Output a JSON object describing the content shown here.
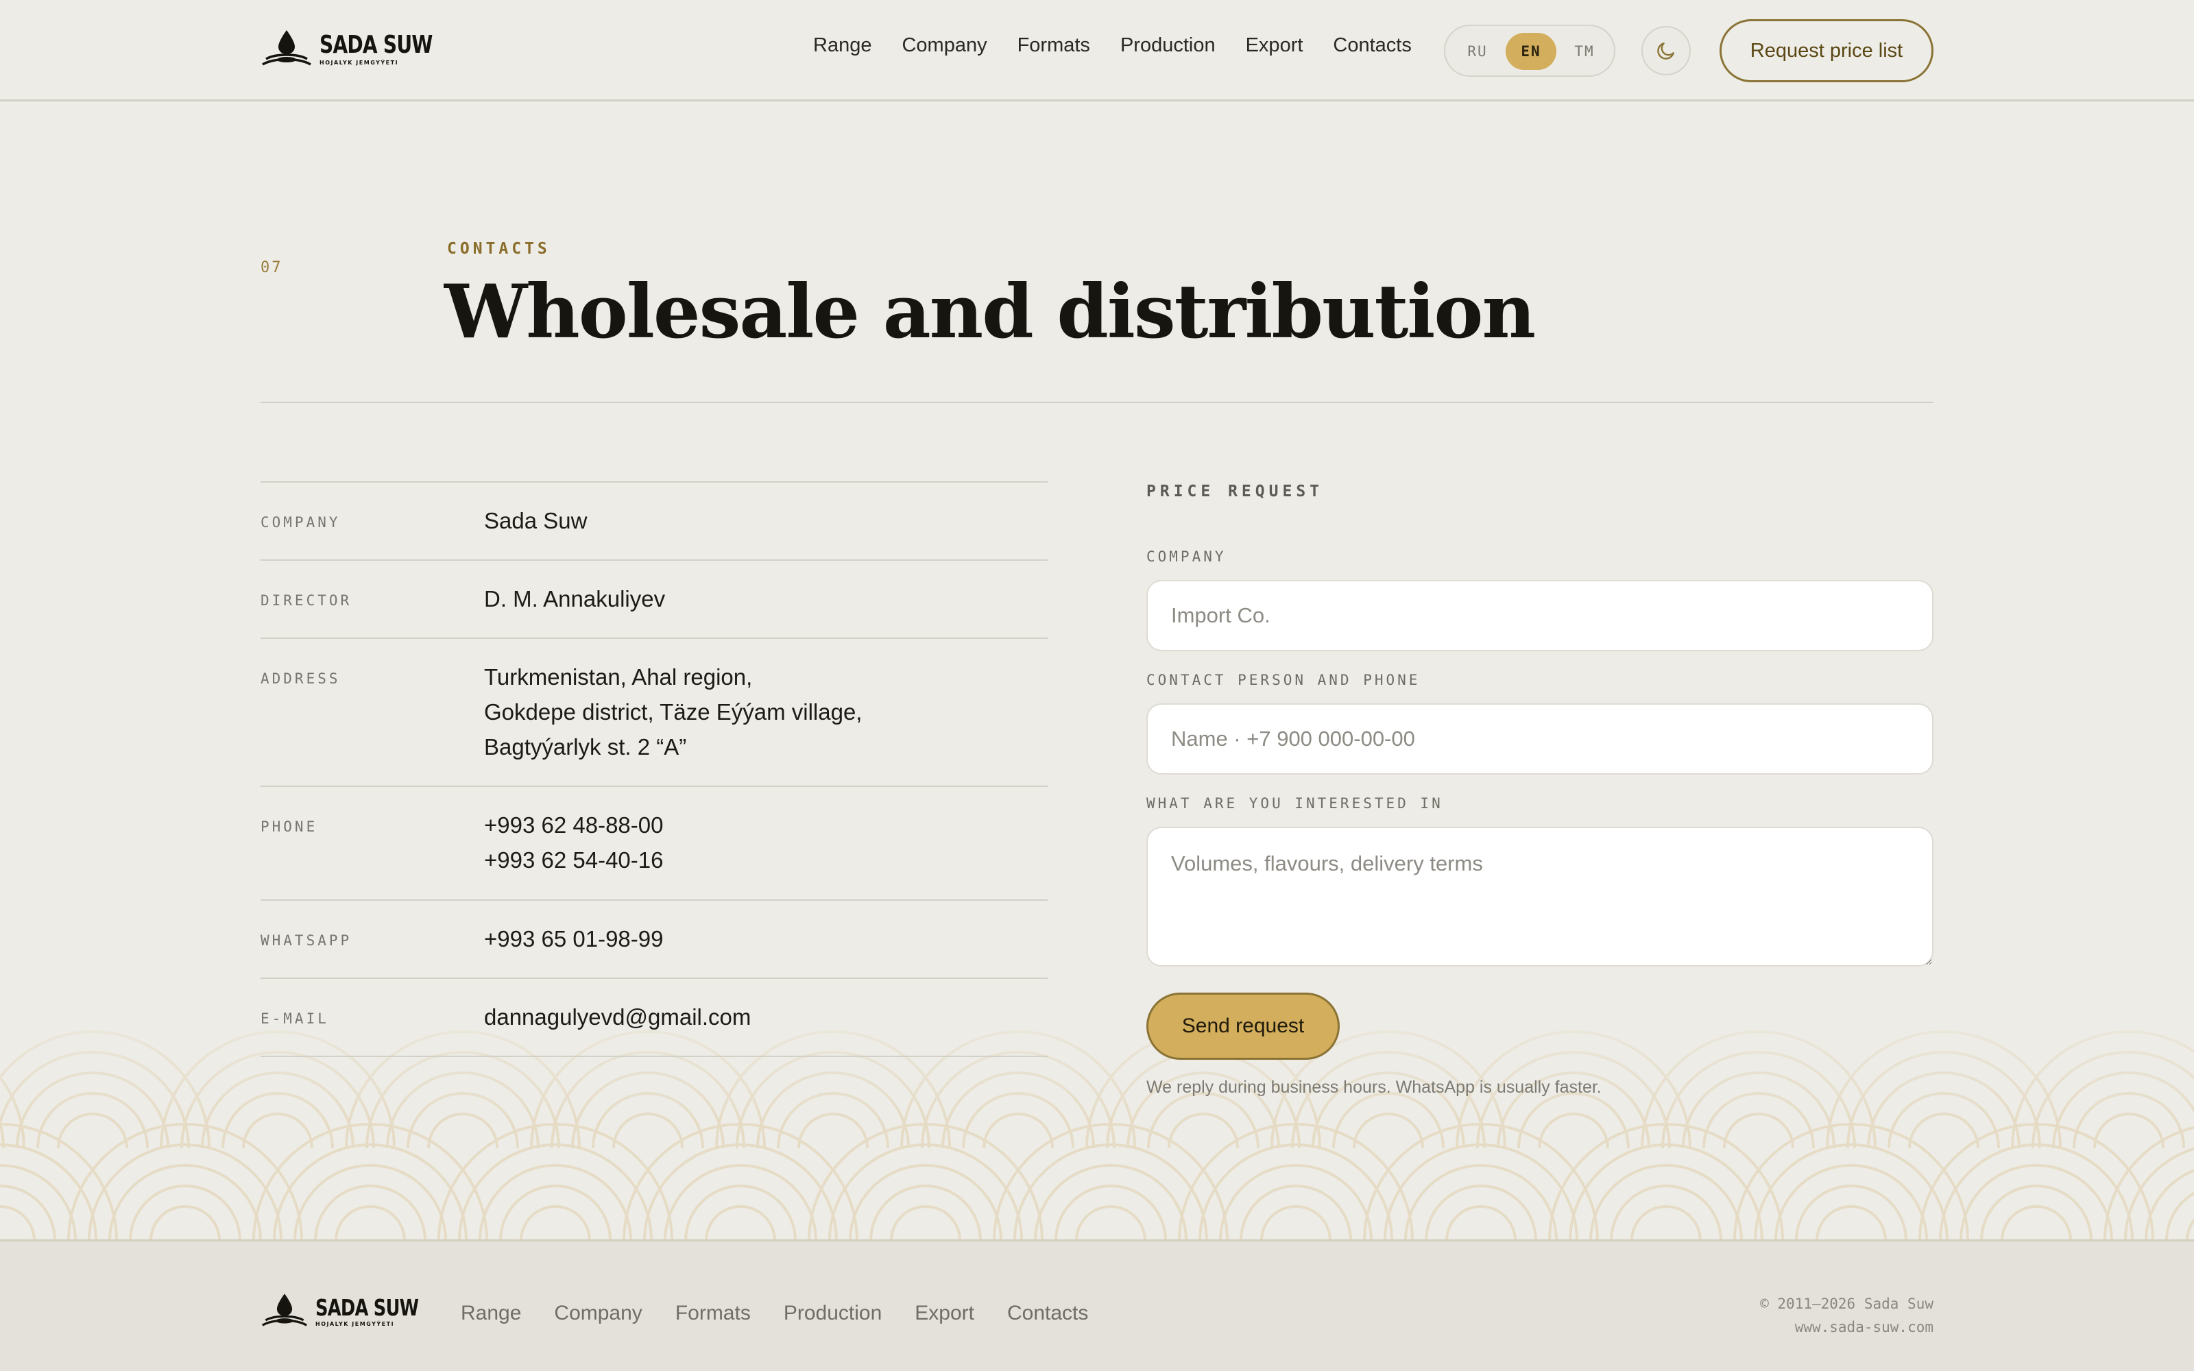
{
  "header": {
    "brand": "SADA SUW",
    "brand_sub": "HOJALYK JEMGYÝETI",
    "nav": [
      "Range",
      "Company",
      "Formats",
      "Production",
      "Export",
      "Contacts"
    ],
    "languages": [
      "RU",
      "EN",
      "TM"
    ],
    "active_language": "EN",
    "theme_icon": "moon-icon",
    "cta_label": "Request price list"
  },
  "section": {
    "number": "07",
    "eyebrow": "CONTACTS",
    "title": "Wholesale and distribution"
  },
  "contacts": [
    {
      "key": "COMPANY",
      "value": "Sada Suw"
    },
    {
      "key": "DIRECTOR",
      "value": "D. M. Annakuliyev"
    },
    {
      "key": "ADDRESS",
      "lines": [
        "Turkmenistan, Ahal region,",
        "Gokdepe district, Täze Eýýam village,",
        "Bagtyýarlyk st. 2 “A”"
      ]
    },
    {
      "key": "PHONE",
      "lines": [
        "+993 62 48-88-00",
        "+993 62 54-40-16"
      ]
    },
    {
      "key": "WHATSAPP",
      "value": "+993 65 01-98-99"
    },
    {
      "key": "E-MAIL",
      "value": "dannagulyevd@gmail.com"
    }
  ],
  "form": {
    "title": "PRICE REQUEST",
    "company_label": "COMPANY",
    "company_placeholder": "Import Co.",
    "contact_label": "CONTACT PERSON AND PHONE",
    "contact_placeholder": "Name · +7 900 000-00-00",
    "interest_label": "WHAT ARE YOU INTERESTED IN",
    "interest_placeholder": "Volumes, flavours, delivery terms",
    "submit_label": "Send request",
    "note": "We reply during business hours. WhatsApp is usually faster."
  },
  "footer": {
    "brand": "SADA SUW",
    "brand_sub": "HOJALYK JEMGYÝETI",
    "nav": [
      "Range",
      "Company",
      "Formats",
      "Production",
      "Export",
      "Contacts"
    ],
    "copyright": "© 2011—2026 Sada Suw",
    "site": "www.sada-suw.com"
  },
  "colors": {
    "background": "#edece7",
    "accent_gold": "#d3ae5c",
    "accent_dark_gold": "#8a7334",
    "pattern": "#e6dcc6"
  }
}
